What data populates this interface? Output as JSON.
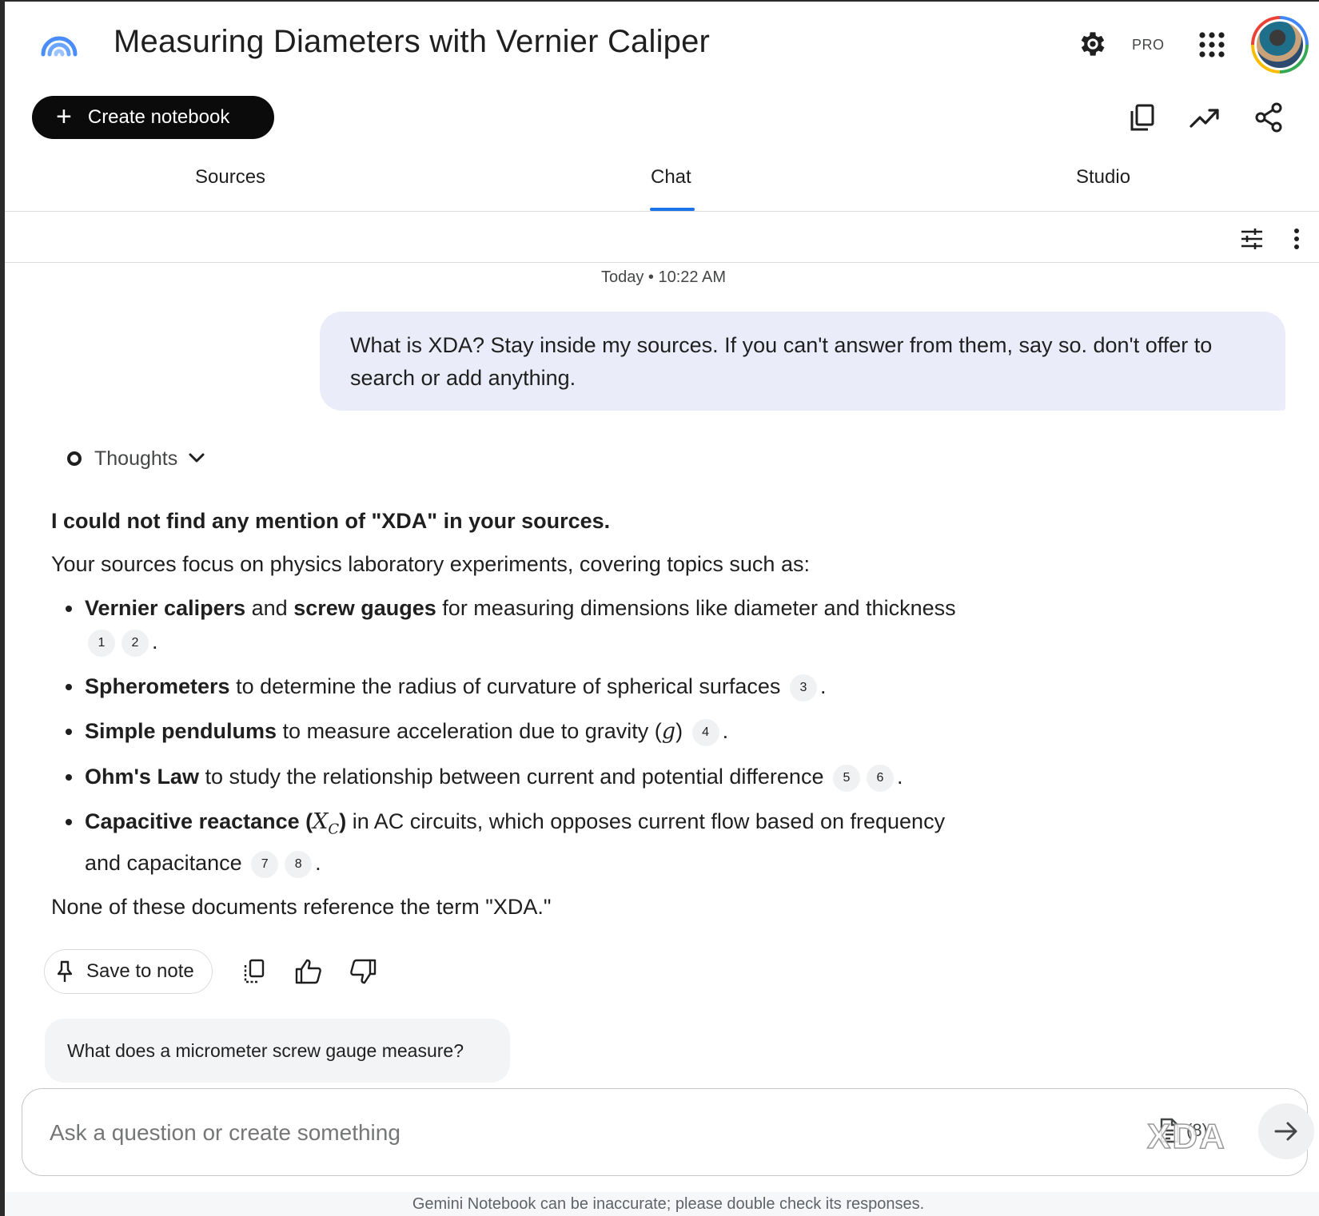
{
  "header": {
    "title": "Measuring Diameters with Vernier Caliper",
    "pro_label": "PRO"
  },
  "toolbar": {
    "create_label": "Create notebook"
  },
  "tabs": [
    {
      "label": "Sources"
    },
    {
      "label": "Chat",
      "active": true
    },
    {
      "label": "Studio"
    }
  ],
  "chat": {
    "timestamp": "Today • 10:22 AM",
    "user_message": "What is XDA? Stay inside my sources. If you can't answer from them, say so. don't offer to search or add anything.",
    "thoughts_label": "Thoughts",
    "answer": {
      "heading": "I could not find any mention of \"XDA\" in your sources.",
      "intro": "Your sources focus on physics laboratory experiments, covering topics such as:",
      "bullets": [
        {
          "bold": "Vernier calipers",
          "mid": " and ",
          "bold2": "screw gauges",
          "text": " for measuring dimensions like diameter and thickness",
          "cites": [
            "1",
            "2"
          ]
        },
        {
          "bold": "Spherometers",
          "text": " to determine the radius of curvature of spherical surfaces",
          "cites": [
            "3"
          ]
        },
        {
          "bold": "Simple pendulums",
          "text": " to measure acceleration due to gravity",
          "math": "g",
          "cites": [
            "4"
          ]
        },
        {
          "bold": "Ohm's Law",
          "text": " to study the relationship between current and potential difference",
          "cites": [
            "5",
            "6"
          ]
        },
        {
          "bold": "Capacitive reactance",
          "math_sym": "X",
          "math_sub": "C",
          "text": " in AC circuits, which opposes current flow based on frequency and capacitance",
          "cites": [
            "7",
            "8"
          ]
        }
      ],
      "outro": "None of these documents reference the term \"XDA.\""
    },
    "save_label": "Save to note",
    "suggestion": "What does a micrometer screw gauge measure?"
  },
  "input": {
    "placeholder": "Ask a question or create something",
    "source_count": "(8)"
  },
  "watermark": "XDA",
  "footer": "Gemini Notebook can be inaccurate; please double check its responses.",
  "colors": {
    "accent": "#1a73e8",
    "user_bubble": "#eaedf9",
    "create_button": "#0b0b0b"
  }
}
